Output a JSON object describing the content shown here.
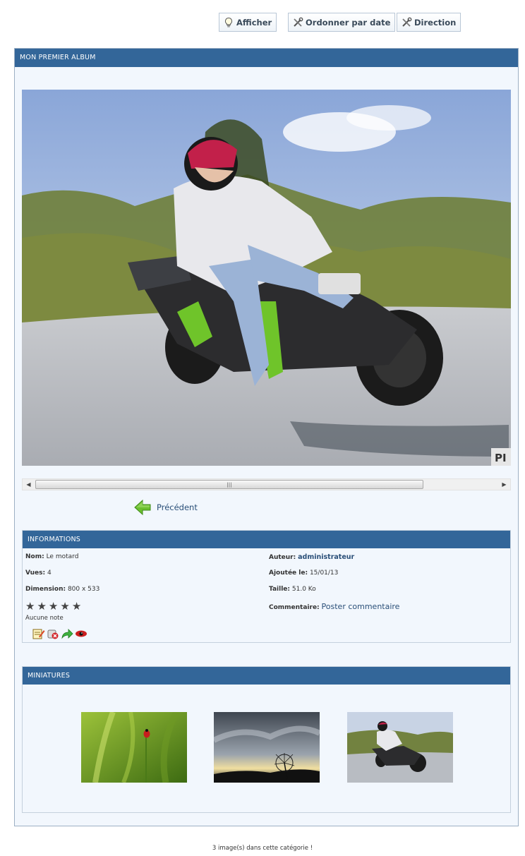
{
  "toolbar": {
    "show_label": "Afficher",
    "sort_label": "Ordonner par date",
    "direction_label": "Direction"
  },
  "album": {
    "title": "MON PREMIER ALBUM",
    "watermark": "PI",
    "prev_label": "Précédent"
  },
  "info": {
    "title": "INFORMATIONS",
    "name_label": "Nom:",
    "name_value": "Le motard",
    "author_label": "Auteur:",
    "author_value": "administrateur",
    "views_label": "Vues:",
    "views_value": "4",
    "added_label": "Ajoutée le:",
    "added_value": "15/01/13",
    "dimension_label": "Dimension:",
    "dimension_value": "800 x 533",
    "size_label": "Taille:",
    "size_value": "51.0 Ko",
    "comment_label": "Commentaire:",
    "comment_link": "Poster commentaire",
    "rating_text": "Aucune note",
    "rating": 0,
    "rating_max": 5
  },
  "miniatures": {
    "title": "MINIATURES",
    "items": [
      "ladybug-thumbnail",
      "dandelion-sunset-thumbnail",
      "motorcycle-thumbnail"
    ]
  },
  "footer": {
    "count_text": "3 image(s) dans cette catégorie !"
  },
  "colors": {
    "header_blue": "#336699",
    "panel_bg": "#f2f7fd",
    "link": "#2a4f78"
  }
}
